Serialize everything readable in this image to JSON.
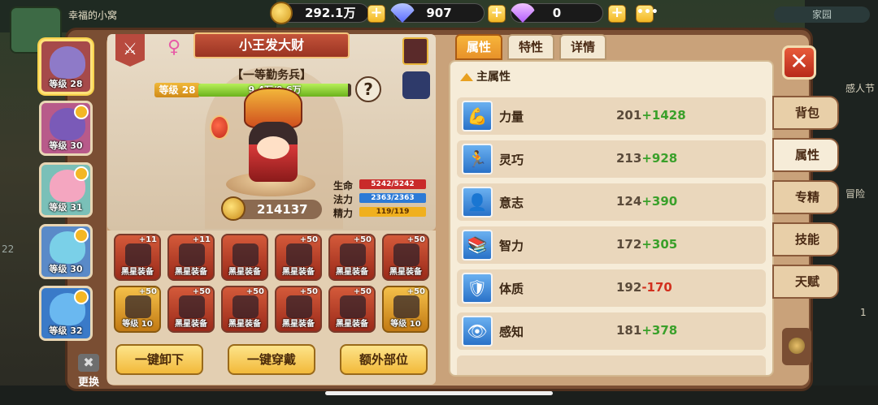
{
  "background": {
    "home_title": "幸福的小窝",
    "home_button": "家园",
    "left_text": "22",
    "right_text1": "感人节",
    "right_text2": "冒险",
    "right_text3": "1"
  },
  "currency": {
    "gold": "292.1万",
    "diamond": "907",
    "purple_gem": "0"
  },
  "heroes": [
    {
      "level": "等级 28",
      "color": "#a64a4a",
      "face": "#8e7ac8",
      "selected": true
    },
    {
      "level": "等级 30",
      "color": "#b85a8a",
      "face": "#7a5ab8"
    },
    {
      "level": "等级 31",
      "color": "#7ac0b8",
      "face": "#f4a6c0"
    },
    {
      "level": "等级 30",
      "color": "#5a8ac8",
      "face": "#7ad0e8"
    },
    {
      "level": "等级 32",
      "color": "#3a7ac8",
      "face": "#6ab8f0"
    }
  ],
  "swap_label": "更换",
  "character": {
    "name": "小王发大财",
    "title": "【一等勤务兵】",
    "level": "等级 28",
    "exp_text": "9.4万/9.6万",
    "exp_fraction": 0.98,
    "power": "214137",
    "stats": [
      {
        "label": "生命",
        "value": "5242/5242"
      },
      {
        "label": "法力",
        "value": "2363/2363"
      },
      {
        "label": "精力",
        "value": "119/119"
      }
    ]
  },
  "equipment": [
    {
      "plus": "+11",
      "label": "黑星装备"
    },
    {
      "plus": "+11",
      "label": "黑星装备"
    },
    {
      "plus": "",
      "label": "黑星装备"
    },
    {
      "plus": "+50",
      "label": "黑星装备"
    },
    {
      "plus": "+50",
      "label": "黑星装备"
    },
    {
      "plus": "+50",
      "label": "黑星装备"
    },
    {
      "plus": "+50",
      "label": "等级 10"
    },
    {
      "plus": "+50",
      "label": "黑星装备"
    },
    {
      "plus": "+50",
      "label": "黑星装备"
    },
    {
      "plus": "+50",
      "label": "黑星装备"
    },
    {
      "plus": "+50",
      "label": "黑星装备"
    },
    {
      "plus": "+50",
      "label": "等级 10"
    }
  ],
  "actions": {
    "unequip_all": "一键卸下",
    "equip_all": "一键穿戴",
    "extra_slots": "额外部位"
  },
  "attr_tabs": [
    "属性",
    "特性",
    "详情"
  ],
  "attr_section": "主属性",
  "attributes": [
    {
      "name": "力量",
      "base": "201",
      "bonus": "+1428",
      "positive": true,
      "icon": "💪"
    },
    {
      "name": "灵巧",
      "base": "213",
      "bonus": "+928",
      "positive": true,
      "icon": "🏃"
    },
    {
      "name": "意志",
      "base": "124",
      "bonus": "+390",
      "positive": true,
      "icon": "👤"
    },
    {
      "name": "智力",
      "base": "172",
      "bonus": "+305",
      "positive": true,
      "icon": "📚"
    },
    {
      "name": "体质",
      "base": "192",
      "bonus": "-170",
      "positive": false,
      "icon": "🛡"
    },
    {
      "name": "感知",
      "base": "181",
      "bonus": "+378",
      "positive": true,
      "icon": "👁"
    }
  ],
  "side_tabs": [
    "背包",
    "属性",
    "专精",
    "技能",
    "天赋"
  ],
  "active_side_tab": 1
}
